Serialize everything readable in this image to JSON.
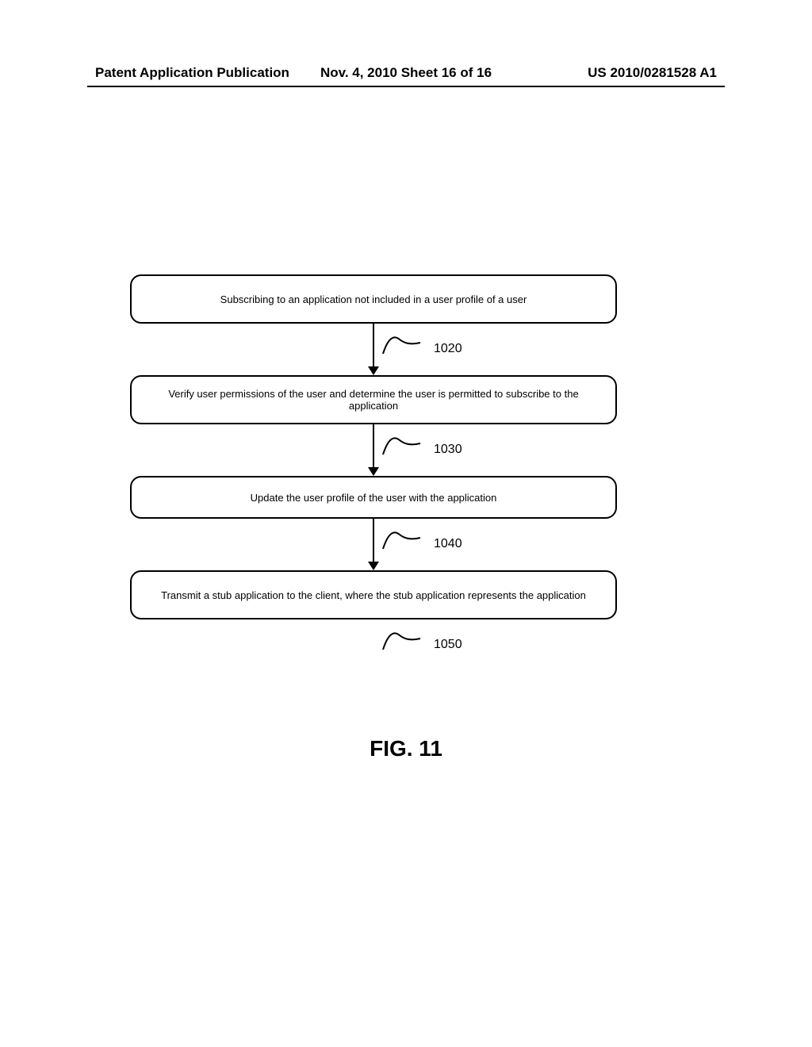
{
  "header": {
    "left": "Patent Application Publication",
    "middle": "Nov. 4, 2010   Sheet 16 of 16",
    "right": "US 2010/0281528 A1"
  },
  "chart_data": {
    "type": "flowchart",
    "title": "FIG. 11",
    "steps": [
      {
        "ref": "1020",
        "text": "Subscribing to an application not included in a user profile of a user"
      },
      {
        "ref": "1030",
        "text": "Verify user permissions of the user and determine the user is permitted to subscribe to the application"
      },
      {
        "ref": "1040",
        "text": "Update the user profile of the user with the application"
      },
      {
        "ref": "1050",
        "text": "Transmit a stub application to the client, where the stub application represents the application"
      }
    ]
  },
  "figure_caption": "FIG. 11"
}
